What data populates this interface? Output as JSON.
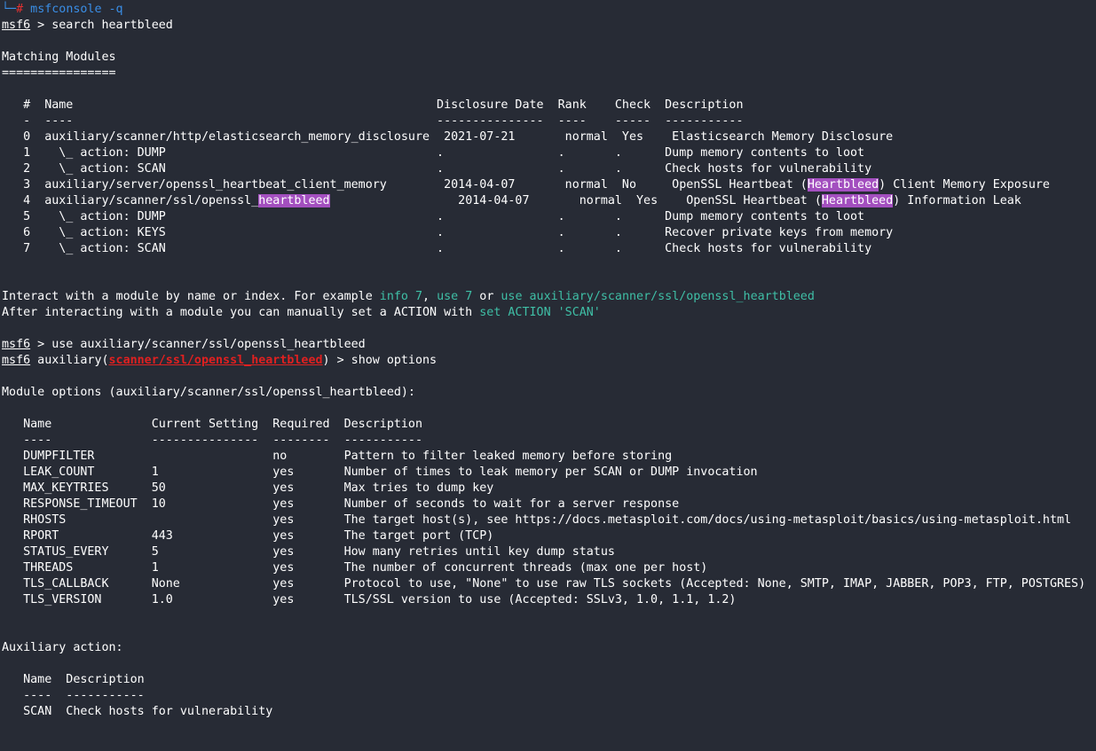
{
  "colors": {
    "background": "#272b35",
    "text": "#ffffff",
    "prompt_blue": "#3a8ee6",
    "root_hash_red": "#e03131",
    "hint_teal": "#3fbfa6",
    "highlight_purple": "#a34fbf"
  },
  "lines": [
    [
      {
        "t": "└─",
        "c": "blue"
      },
      {
        "t": "#",
        "c": "red"
      },
      {
        "t": " msfconsole -q",
        "c": "blue"
      }
    ],
    [
      {
        "t": "msf6",
        "c": "ul"
      },
      {
        "t": " > search heartbleed"
      }
    ],
    [],
    [
      {
        "t": "Matching Modules"
      }
    ],
    [
      {
        "t": "================"
      }
    ],
    [],
    [
      {
        "t": "   #  Name                                                   Disclosure Date  Rank    Check  Description"
      }
    ],
    [
      {
        "t": "   -  ----                                                   ---------------  ----    -----  -----------"
      }
    ],
    [
      {
        "t": "   0  auxiliary/scanner/http/elasticsearch_memory_disclosure  2021-07-21       normal  Yes    Elasticsearch Memory Disclosure"
      }
    ],
    [
      {
        "t": "   1    \\_ action: DUMP                                      .                .       .      Dump memory contents to loot"
      }
    ],
    [
      {
        "t": "   2    \\_ action: SCAN                                      .                .       .      Check hosts for vulnerability"
      }
    ],
    [
      {
        "t": "   3  auxiliary/server/openssl_heartbeat_client_memory        2014-04-07       normal  No     OpenSSL Heartbeat ("
      },
      {
        "t": "Heartbleed",
        "c": "hl"
      },
      {
        "t": ") Client Memory Exposure"
      }
    ],
    [
      {
        "t": "   4  auxiliary/scanner/ssl/openssl_"
      },
      {
        "t": "heartbleed",
        "c": "hl"
      },
      {
        "t": "                  2014-04-07       normal  Yes    OpenSSL Heartbeat ("
      },
      {
        "t": "Heartbleed",
        "c": "hl"
      },
      {
        "t": ") Information Leak"
      }
    ],
    [
      {
        "t": "   5    \\_ action: DUMP                                      .                .       .      Dump memory contents to loot"
      }
    ],
    [
      {
        "t": "   6    \\_ action: KEYS                                      .                .       .      Recover private keys from memory"
      }
    ],
    [
      {
        "t": "   7    \\_ action: SCAN                                      .                .       .      Check hosts for vulnerability"
      }
    ],
    [],
    [],
    [
      {
        "t": "Interact with a module by name or index. For example "
      },
      {
        "t": "info 7",
        "c": "teal"
      },
      {
        "t": ", "
      },
      {
        "t": "use 7",
        "c": "teal"
      },
      {
        "t": " or "
      },
      {
        "t": "use auxiliary/scanner/ssl/openssl_heartbleed",
        "c": "teal"
      }
    ],
    [
      {
        "t": "After interacting with a module you can manually set a ACTION with "
      },
      {
        "t": "set ACTION 'SCAN'",
        "c": "teal"
      }
    ],
    [],
    [
      {
        "t": "msf6",
        "c": "ul"
      },
      {
        "t": " > use auxiliary/scanner/ssl/openssl_heartbleed"
      }
    ],
    [
      {
        "t": "msf6",
        "c": "ul"
      },
      {
        "t": " auxiliary("
      },
      {
        "t": "scanner/ssl/openssl_heartbleed",
        "c": "redbold"
      },
      {
        "t": ") > show options"
      }
    ],
    [],
    [
      {
        "t": "Module options (auxiliary/scanner/ssl/openssl_heartbleed):"
      }
    ],
    [],
    [
      {
        "t": "   Name              Current Setting  Required  Description"
      }
    ],
    [
      {
        "t": "   ----              ---------------  --------  -----------"
      }
    ],
    [
      {
        "t": "   DUMPFILTER                         no        Pattern to filter leaked memory before storing"
      }
    ],
    [
      {
        "t": "   LEAK_COUNT        1                yes       Number of times to leak memory per SCAN or DUMP invocation"
      }
    ],
    [
      {
        "t": "   MAX_KEYTRIES      50               yes       Max tries to dump key"
      }
    ],
    [
      {
        "t": "   RESPONSE_TIMEOUT  10               yes       Number of seconds to wait for a server response"
      }
    ],
    [
      {
        "t": "   RHOSTS                             yes       The target host(s), see https://docs.metasploit.com/docs/using-metasploit/basics/using-metasploit.html"
      }
    ],
    [
      {
        "t": "   RPORT             443              yes       The target port (TCP)"
      }
    ],
    [
      {
        "t": "   STATUS_EVERY      5                yes       How many retries until key dump status"
      }
    ],
    [
      {
        "t": "   THREADS           1                yes       The number of concurrent threads (max one per host)"
      }
    ],
    [
      {
        "t": "   TLS_CALLBACK      None             yes       Protocol to use, \"None\" to use raw TLS sockets (Accepted: None, SMTP, IMAP, JABBER, POP3, FTP, POSTGRES)"
      }
    ],
    [
      {
        "t": "   TLS_VERSION       1.0              yes       TLS/SSL version to use (Accepted: SSLv3, 1.0, 1.1, 1.2)"
      }
    ],
    [],
    [],
    [
      {
        "t": "Auxiliary action:"
      }
    ],
    [],
    [
      {
        "t": "   Name  Description"
      }
    ],
    [
      {
        "t": "   ----  -----------"
      }
    ],
    [
      {
        "t": "   SCAN  Check hosts for vulnerability"
      }
    ]
  ]
}
